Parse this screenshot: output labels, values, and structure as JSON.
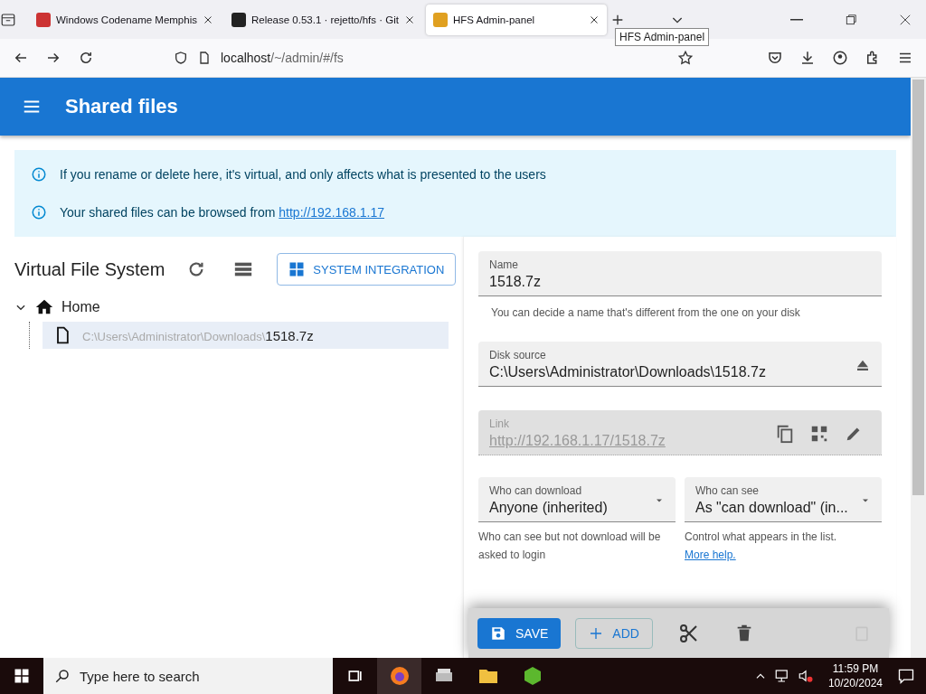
{
  "browser": {
    "tabs": [
      {
        "title": "Windows Codename Memphis",
        "selected": false
      },
      {
        "title": "Release 0.53.1 · rejetto/hfs · Git",
        "selected": false
      },
      {
        "title": "HFS Admin-panel",
        "selected": true
      }
    ],
    "tooltip": "HFS Admin-panel",
    "url": {
      "host": "localhost",
      "path": "/~/admin/#/fs"
    }
  },
  "app_bar": {
    "title": "Shared files"
  },
  "notices": [
    {
      "text": "If you rename or delete here, it's virtual, and only affects what is presented to the users"
    },
    {
      "text": "Your shared files can be browsed from",
      "link": "http://192.168.1.17"
    }
  ],
  "vfs": {
    "title": "Virtual File System",
    "integration_button": "SYSTEM INTEGRATION",
    "tree": [
      {
        "label": "Home",
        "expanded": true,
        "children": [
          {
            "path_prefix": "C:\\Users\\Administrator\\Downloads\\",
            "name": "1518.7z",
            "selected": true
          }
        ]
      }
    ]
  },
  "details": {
    "name": {
      "label": "Name",
      "value": "1518.7z",
      "helper": "You can decide a name that's different from the one on your disk"
    },
    "source": {
      "label": "Disk source",
      "value": "C:\\Users\\Administrator\\Downloads\\1518.7z"
    },
    "link": {
      "label": "Link",
      "value": "http://192.168.1.17/1518.7z"
    },
    "selects": [
      {
        "label": "Who can download",
        "value": "Anyone (inherited)",
        "helper": "Who can see but not download will be asked to login"
      },
      {
        "label": "Who can see",
        "value": "As \"can download\" (in...",
        "helper": "Control what appears in the list.",
        "link": "More help."
      }
    ]
  },
  "actions": {
    "save": "SAVE",
    "add": "ADD"
  },
  "taskbar": {
    "search_placeholder": "Type here to search",
    "time": "11:59 PM",
    "date": "10/20/2024"
  }
}
